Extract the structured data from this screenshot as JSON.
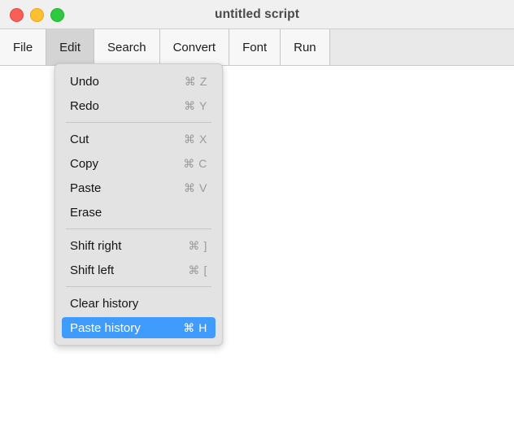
{
  "window": {
    "title": "untitled script",
    "traffic_lights": [
      {
        "name": "close",
        "color": "#fa5f57"
      },
      {
        "name": "minimize",
        "color": "#fec030"
      },
      {
        "name": "maximize",
        "color": "#2dca41"
      }
    ]
  },
  "menubar": {
    "items": [
      {
        "label": "File",
        "active": false
      },
      {
        "label": "Edit",
        "active": true
      },
      {
        "label": "Search",
        "active": false
      },
      {
        "label": "Convert",
        "active": false
      },
      {
        "label": "Font",
        "active": false
      },
      {
        "label": "Run",
        "active": false
      }
    ]
  },
  "dropdown": {
    "owner": "Edit",
    "highlight_color": "#3f9bfc",
    "rows": [
      {
        "type": "item",
        "label": "Undo",
        "shortcut": "⌘ Z",
        "selected": false
      },
      {
        "type": "item",
        "label": "Redo",
        "shortcut": "⌘ Y",
        "selected": false
      },
      {
        "type": "separator"
      },
      {
        "type": "item",
        "label": "Cut",
        "shortcut": "⌘ X",
        "selected": false
      },
      {
        "type": "item",
        "label": "Copy",
        "shortcut": "⌘ C",
        "selected": false
      },
      {
        "type": "item",
        "label": "Paste",
        "shortcut": "⌘ V",
        "selected": false
      },
      {
        "type": "item",
        "label": "Erase",
        "shortcut": "",
        "selected": false
      },
      {
        "type": "separator"
      },
      {
        "type": "item",
        "label": "Shift right",
        "shortcut": "⌘ ]",
        "selected": false
      },
      {
        "type": "item",
        "label": "Shift left",
        "shortcut": "⌘ [",
        "selected": false
      },
      {
        "type": "separator"
      },
      {
        "type": "item",
        "label": "Clear history",
        "shortcut": "",
        "selected": false
      },
      {
        "type": "item",
        "label": "Paste history",
        "shortcut": "⌘ H",
        "selected": true
      }
    ]
  }
}
